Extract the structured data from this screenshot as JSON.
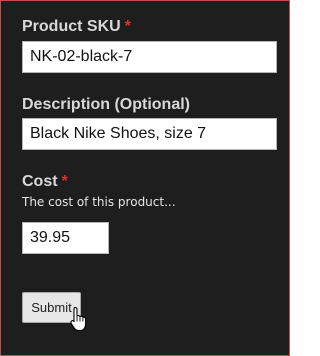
{
  "form": {
    "sku": {
      "label": "Product SKU",
      "required_mark": "*",
      "value": "NK-02-black-7"
    },
    "description": {
      "label": "Description (Optional)",
      "value": "Black Nike Shoes, size 7"
    },
    "cost": {
      "label": "Cost",
      "required_mark": "*",
      "help": "The cost of this product...",
      "value": "39.95"
    },
    "submit_label": "Submit"
  },
  "colors": {
    "background": "#1e1e1e",
    "label": "#d8d8d8",
    "required": "#e03030",
    "border": "#c0504d"
  },
  "icons": {
    "cursor": "hand-pointer-icon"
  }
}
